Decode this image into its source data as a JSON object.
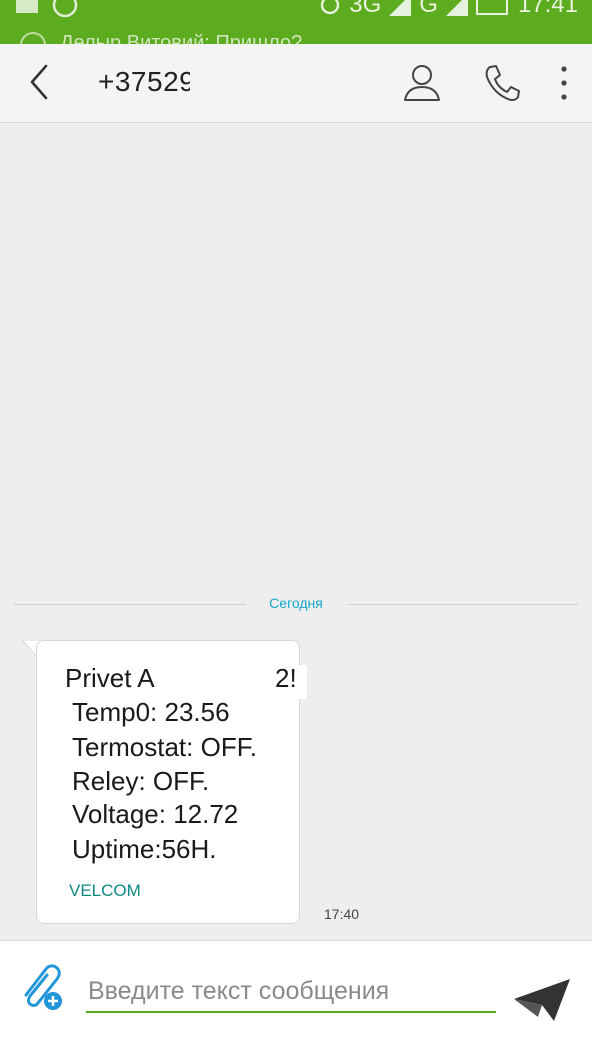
{
  "status_bar": {
    "network_label_1": "3G",
    "network_label_2": "G",
    "time": "17:41",
    "notification_text": "Делыр Витовий: Пришло?"
  },
  "header": {
    "phone_number": "+37529"
  },
  "conversation": {
    "date_separator": "Сегодня",
    "message": {
      "lines": [
        "Privet A",
        "2!",
        "Temp0: 23.56",
        "Termostat: OFF.",
        "Reley: OFF.",
        "Voltage: 12.72",
        "Uptime:56H."
      ],
      "sender": "VELCOM",
      "time": "17:40"
    }
  },
  "composer": {
    "placeholder": "Введите текст сообщения"
  },
  "colors": {
    "accent_green": "#5dab1e",
    "date_label": "#1aa6cc",
    "sender_teal": "#0e8a84",
    "attach_blue": "#2196d9"
  }
}
